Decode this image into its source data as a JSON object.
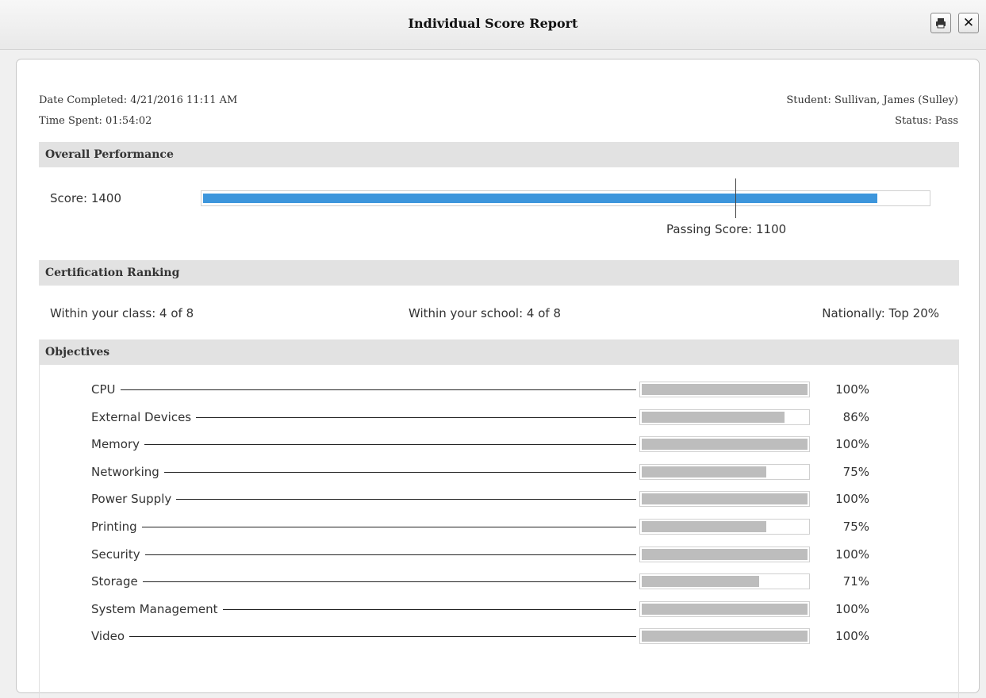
{
  "window": {
    "title": "Individual Score Report"
  },
  "toolbar": {
    "print_icon": "printer-icon",
    "close_label": "✕"
  },
  "meta": {
    "date_completed": "Date Completed: 4/21/2016 11:11 AM",
    "time_spent": "Time Spent: 01:54:02",
    "student": "Student: Sullivan, James (Sulley)",
    "status": "Status: Pass"
  },
  "overall": {
    "heading": "Overall Performance",
    "score_label": "Score: 1400",
    "score_fraction": 0.93,
    "passing_label": "Passing Score: 1100",
    "passing_fraction": 0.733,
    "bar_color": "#3d96dc"
  },
  "ranking": {
    "heading": "Certification Ranking",
    "class": "Within your class: 4 of 8",
    "school": "Within your school: 4 of 8",
    "national": "Nationally: Top 20%"
  },
  "objectives": {
    "heading": "Objectives",
    "bar_color": "#bdbdbd",
    "items": [
      {
        "name": "CPU",
        "percent": 100,
        "label": "100%"
      },
      {
        "name": "External Devices",
        "percent": 86,
        "label": "86%"
      },
      {
        "name": "Memory",
        "percent": 100,
        "label": "100%"
      },
      {
        "name": "Networking",
        "percent": 75,
        "label": "75%"
      },
      {
        "name": "Power Supply",
        "percent": 100,
        "label": "100%"
      },
      {
        "name": "Printing",
        "percent": 75,
        "label": "75%"
      },
      {
        "name": "Security",
        "percent": 100,
        "label": "100%"
      },
      {
        "name": "Storage",
        "percent": 71,
        "label": "71%"
      },
      {
        "name": "System Management",
        "percent": 100,
        "label": "100%"
      },
      {
        "name": "Video",
        "percent": 100,
        "label": "100%"
      }
    ]
  }
}
